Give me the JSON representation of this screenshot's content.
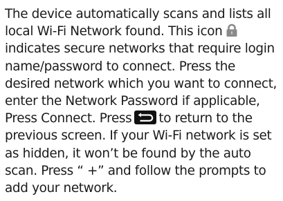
{
  "document": {
    "lines": [
      "The device automatically scans and lists all",
      "local Wi-Fi Network found. This icon",
      "indicates secure networks that require login",
      "name/password to connect. Press the",
      "desired network which you want to connect,",
      "enter the Network Password if applicable,",
      "Press Connect. Press",
      "to return to the",
      "previous screen. If your Wi-Fi network is set",
      "as hidden, it won’t be found by the auto",
      "scan. Press  “ +” and follow the prompts to",
      "add your network."
    ],
    "icons": {
      "lock": "lock-icon",
      "back": "back-arrow-icon"
    },
    "icon_colors": {
      "lock_body": "#8a8a8a",
      "back_bg": "#111111",
      "back_arrow": "#ffffff"
    }
  }
}
